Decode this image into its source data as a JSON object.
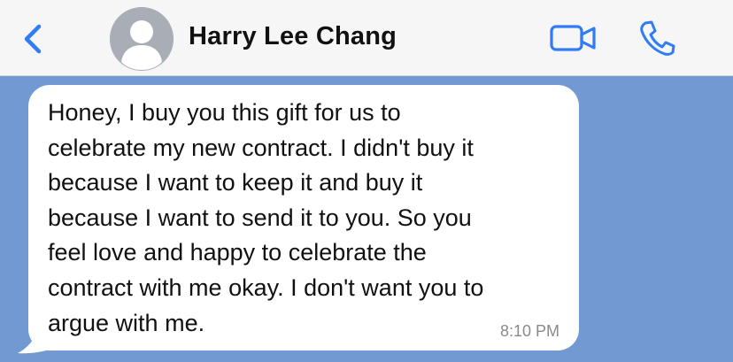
{
  "header": {
    "contact_name": "Harry Lee Chang",
    "accent_color": "#2f7cf6",
    "icons": {
      "back": "chevron-left-icon",
      "avatar": "person-silhouette-icon",
      "video": "video-camera-icon",
      "call": "phone-icon"
    }
  },
  "conversation": {
    "background_color": "#7299d2",
    "messages": [
      {
        "direction": "incoming",
        "lines": [
          "Honey, I buy you this gift for us to",
          "celebrate my new contract. I didn't buy it",
          "because I want to keep it and buy it",
          "because I want to send it to you. So you",
          "feel love and happy to celebrate the",
          "contract with me okay. I don't want you to",
          "argue with me."
        ],
        "time": "8:10 PM"
      }
    ]
  }
}
